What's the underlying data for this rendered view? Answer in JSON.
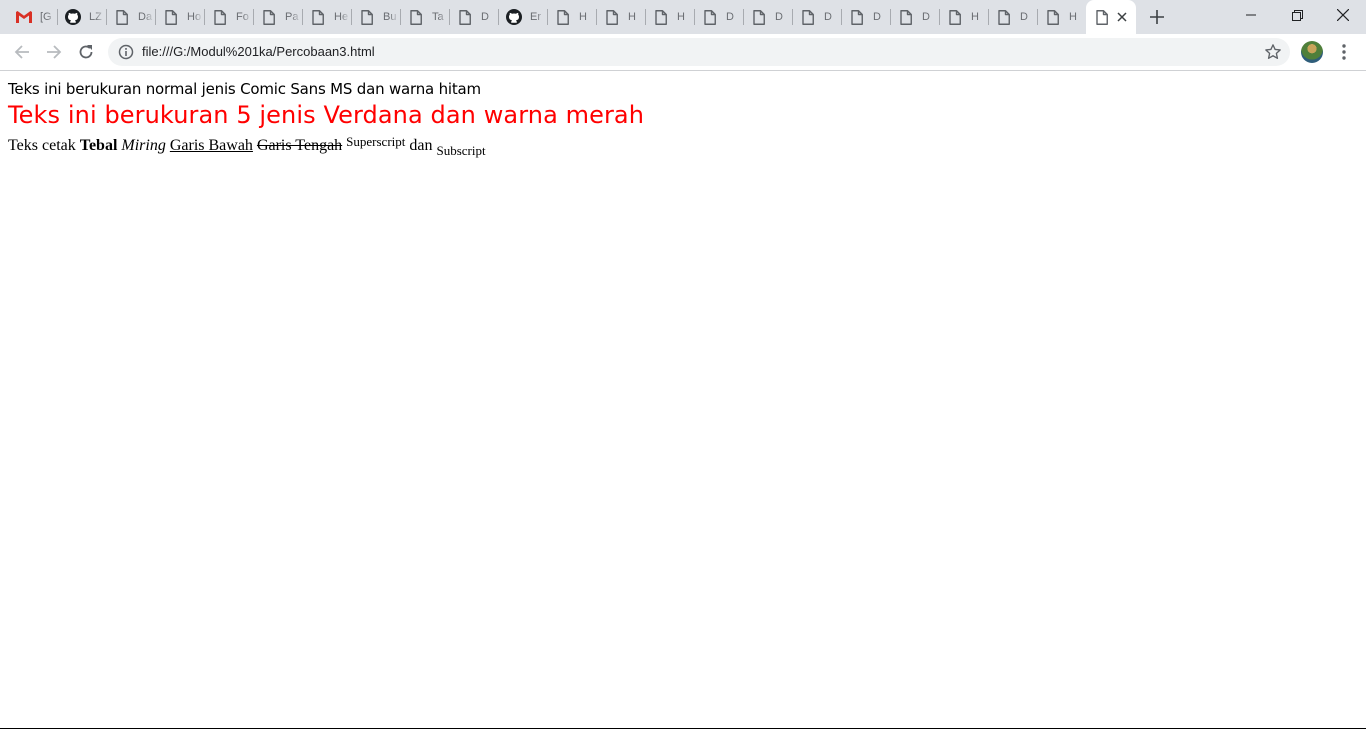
{
  "browser": {
    "tabs": [
      {
        "title": "[G",
        "icon": "gmail-icon"
      },
      {
        "title": "LZ",
        "icon": "github-icon"
      },
      {
        "title": "Da",
        "icon": "file-icon"
      },
      {
        "title": "Ho",
        "icon": "file-icon"
      },
      {
        "title": "Fo",
        "icon": "file-icon"
      },
      {
        "title": "Pa",
        "icon": "file-icon"
      },
      {
        "title": "He",
        "icon": "file-icon"
      },
      {
        "title": "Bu",
        "icon": "file-icon"
      },
      {
        "title": "Ta",
        "icon": "file-icon"
      },
      {
        "title": "D",
        "icon": "file-icon"
      },
      {
        "title": "Er",
        "icon": "github-icon"
      },
      {
        "title": "H",
        "icon": "file-icon"
      },
      {
        "title": "H",
        "icon": "file-icon"
      },
      {
        "title": "H",
        "icon": "file-icon"
      },
      {
        "title": "D",
        "icon": "file-icon"
      },
      {
        "title": "D",
        "icon": "file-icon"
      },
      {
        "title": "D",
        "icon": "file-icon"
      },
      {
        "title": "D",
        "icon": "file-icon"
      },
      {
        "title": "D",
        "icon": "file-icon"
      },
      {
        "title": "H",
        "icon": "file-icon"
      },
      {
        "title": "D",
        "icon": "file-icon"
      },
      {
        "title": "H",
        "icon": "file-icon"
      }
    ],
    "active_tab": {
      "title": "",
      "icon": "file-icon"
    },
    "address": "file:///G:/Modul%201ka/Percobaan3.html"
  },
  "page": {
    "line1": "Teks ini berukuran normal jenis Comic Sans MS dan warna hitam",
    "line2": "Teks ini berukuran 5 jenis Verdana dan warna merah",
    "line2_color": "#ff0000",
    "line3": {
      "intro": "Teks cetak",
      "bold": "Tebal",
      "italic": "Miring",
      "underline": "Garis Bawah",
      "strike": "Garis Tengah",
      "sup": "Superscript",
      "and": "dan",
      "sub": "Subscript"
    }
  }
}
